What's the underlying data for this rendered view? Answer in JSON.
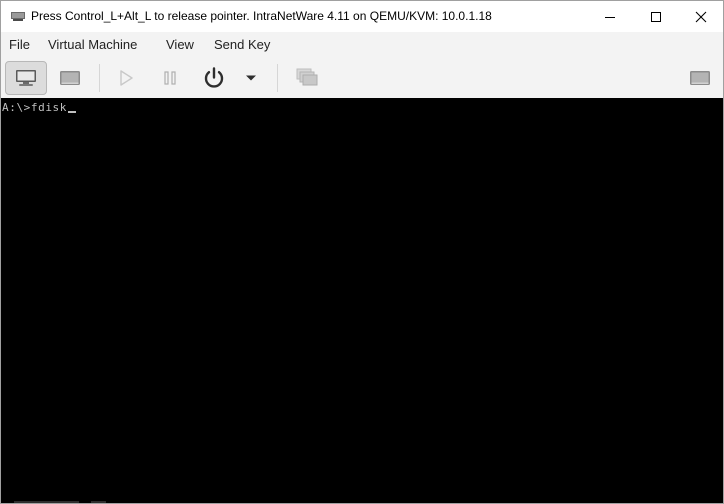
{
  "window": {
    "title": "Press Control_L+Alt_L to release pointer. IntraNetWare 4.11 on QEMU/KVM: 10.0.1.18",
    "app_icon": "virt-manager-icon",
    "controls": [
      "minimize-icon",
      "maximize-icon",
      "close-icon"
    ]
  },
  "menubar": {
    "items": [
      "File",
      "Virtual Machine",
      "View",
      "Send Key"
    ]
  },
  "toolbar": {
    "buttons": [
      {
        "icon": "console-monitor-icon",
        "state": "active"
      },
      {
        "icon": "details-icon",
        "state": "normal"
      },
      {
        "icon": "run-icon",
        "state": "disabled"
      },
      {
        "icon": "pause-icon",
        "state": "disabled"
      },
      {
        "icon": "power-icon",
        "state": "normal"
      },
      {
        "icon": "dropdown-arrow-icon",
        "state": "normal"
      },
      {
        "icon": "snapshots-icon",
        "state": "disabled"
      },
      {
        "icon": "fullscreen-icon",
        "state": "normal"
      }
    ]
  },
  "console": {
    "prompt": "A:\\>",
    "command": "fdisk",
    "background": "#000000",
    "text_color": "#c0c0c0"
  }
}
